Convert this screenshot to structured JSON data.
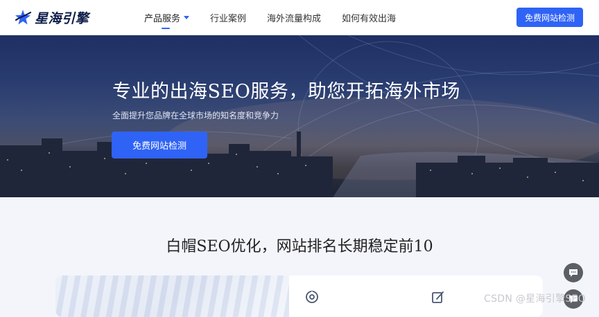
{
  "brand": {
    "name": "星海引擎",
    "color": "#2f63f6",
    "logo_icon": "star-logo-icon"
  },
  "nav": {
    "items": [
      {
        "label": "产品服务",
        "active": true,
        "has_dropdown": true
      },
      {
        "label": "行业案例"
      },
      {
        "label": "海外流量构成"
      },
      {
        "label": "如何有效出海"
      }
    ]
  },
  "header": {
    "cta_label": "免费网站检测"
  },
  "hero": {
    "title": "专业的出海SEO服务，助您开拓海外市场",
    "subtitle": "全面提升您品牌在全球市场的知名度和竞争力",
    "cta_label": "免费网站检测"
  },
  "section": {
    "title": "白帽SEO优化，网站排名长期稳定前10",
    "features": [
      {
        "icon": "target-ring-icon"
      },
      {
        "icon": "edit-document-icon"
      }
    ]
  },
  "floating": {
    "buttons": [
      "chat-icon",
      "chat-icon"
    ]
  },
  "watermark": "CSDN @星海引擎SEO"
}
